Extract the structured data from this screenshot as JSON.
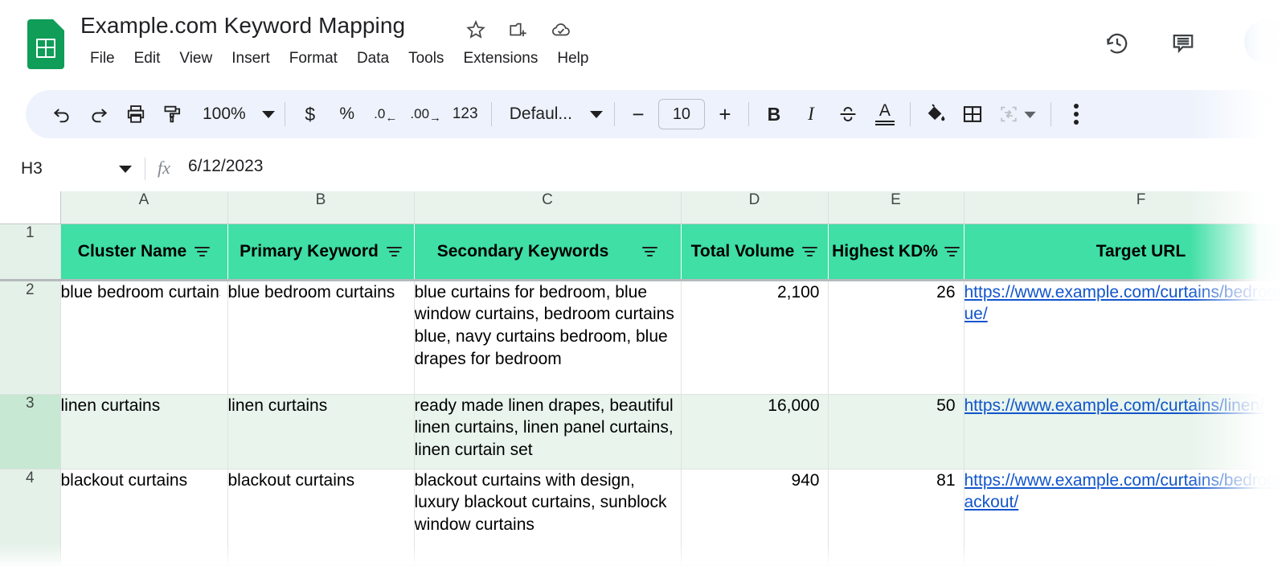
{
  "app": {
    "doc_title": "Example.com Keyword Mapping",
    "logo_icon": "sheets-logo-icon",
    "title_icons": [
      "star-icon",
      "move-to-folder-icon",
      "cloud-saved-icon"
    ],
    "menus": [
      "File",
      "Edit",
      "View",
      "Insert",
      "Format",
      "Data",
      "Tools",
      "Extensions",
      "Help"
    ],
    "top_right_icons": [
      "version-history-icon",
      "comment-icon"
    ],
    "accent_header_color": "#3fdfa5",
    "link_color": "#1155cc"
  },
  "toolbar": {
    "undo": "undo-icon",
    "redo": "redo-icon",
    "print": "print-icon",
    "paint_format": "paint-format-icon",
    "zoom_value": "100%",
    "currency": "$",
    "percent": "%",
    "decrease_decimal": ".0",
    "increase_decimal": ".00",
    "more_formats": "123",
    "font_family": "Defaul...",
    "font_decrease": "−",
    "font_size": "10",
    "font_increase": "+",
    "bold": "B",
    "italic": "I",
    "strikethrough": "strikethrough-icon",
    "text_color": "A",
    "fill_color": "fill-color-icon",
    "borders": "borders-icon",
    "merge_cells": "merge-cells-icon",
    "more": "more-options-icon"
  },
  "formula_bar": {
    "name_box": "H3",
    "fx_label": "fx",
    "content": "6/12/2023"
  },
  "grid": {
    "column_letters": [
      "A",
      "B",
      "C",
      "D",
      "E",
      "F"
    ],
    "row_numbers": [
      "1",
      "2",
      "3",
      "4"
    ],
    "active_row": "3",
    "headers": [
      {
        "label": "Cluster Name",
        "filter": true
      },
      {
        "label": "Primary Keyword",
        "filter": true
      },
      {
        "label": "Secondary Keywords",
        "filter": true
      },
      {
        "label": "Total Volume",
        "filter": true
      },
      {
        "label": "Highest KD%",
        "filter": true
      },
      {
        "label": "Target URL",
        "filter": true
      }
    ],
    "rows": [
      {
        "n": "2",
        "banded": false,
        "cluster_name": "blue bedroom curtains",
        "primary_keyword": "blue bedroom curtains",
        "secondary_keywords": "blue curtains for bedroom, blue window curtains, bedroom curtains blue, navy curtains bedroom, blue drapes for bedroom",
        "total_volume": "2,100",
        "highest_kd": "26",
        "target_url": "https://www.example.com/curtains/bedroom/blue/"
      },
      {
        "n": "3",
        "banded": true,
        "cluster_name": "linen curtains",
        "primary_keyword": "linen curtains",
        "secondary_keywords": "ready made linen drapes, beautiful linen curtains, linen panel curtains, linen curtain set",
        "total_volume": "16,000",
        "highest_kd": "50",
        "target_url": "https://www.example.com/curtains/linen/"
      },
      {
        "n": "4",
        "banded": false,
        "cluster_name": "blackout curtains",
        "primary_keyword": "blackout curtains",
        "secondary_keywords": "blackout curtains with design, luxury blackout curtains, sunblock window curtains",
        "total_volume": "940",
        "highest_kd": "81",
        "target_url": "https://www.example.com/curtains/bedroom/blackout/"
      }
    ]
  }
}
